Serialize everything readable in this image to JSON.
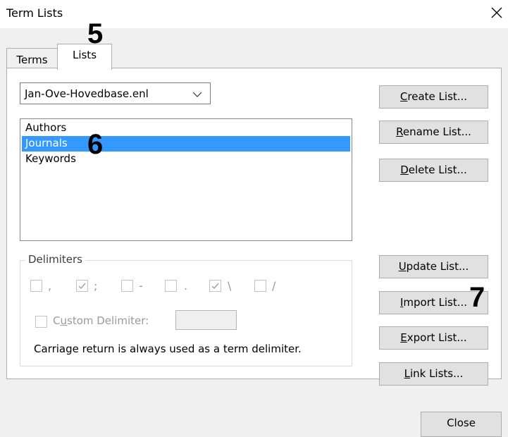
{
  "window": {
    "title": "Term Lists"
  },
  "tabs": [
    {
      "label": "Terms",
      "active": false
    },
    {
      "label": "Lists",
      "active": true
    }
  ],
  "database_select": {
    "value": "Jan-Ove-Hovedbase.enl"
  },
  "lists": {
    "items": [
      "Authors",
      "Journals",
      "Keywords"
    ],
    "selected": "Journals"
  },
  "delimiters": {
    "legend": "Delimiters",
    "options": [
      {
        "symbol": ",",
        "checked": false
      },
      {
        "symbol": ";",
        "checked": true
      },
      {
        "symbol": "-",
        "checked": false
      },
      {
        "symbol": ".",
        "checked": false
      },
      {
        "symbol": "\\",
        "checked": true
      },
      {
        "symbol": "/",
        "checked": false
      }
    ],
    "custom": {
      "label_pre": "C",
      "label_accel": "u",
      "label_post": "stom Delimiter:",
      "checked": false,
      "value": ""
    },
    "note": "Carriage return is always used as a term delimiter."
  },
  "buttons": {
    "create": {
      "accel": "C",
      "rest": "reate List..."
    },
    "rename": {
      "accel": "R",
      "rest": "ename List..."
    },
    "delete": {
      "accel": "D",
      "rest": "elete List..."
    },
    "update": {
      "accel": "U",
      "rest": "pdate List..."
    },
    "import": {
      "accel": "I",
      "rest": "mport List..."
    },
    "export": {
      "accel": "E",
      "rest": "xport List..."
    },
    "link": {
      "accel": "L",
      "rest": "ink Lists..."
    },
    "close": "Close"
  },
  "annotations": [
    "5",
    "6",
    "7"
  ],
  "colors": {
    "selection": "#3399ff",
    "button_face": "#e1e1e1",
    "disabled_text": "#9a9a9a"
  }
}
